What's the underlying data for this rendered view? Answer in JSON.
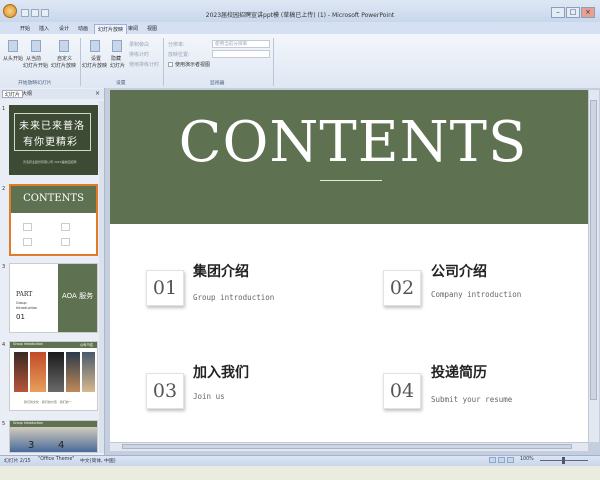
{
  "window": {
    "title": "2023届校园招聘宣讲ppt模 (草稿已上传) (1) - Microsoft PowerPoint",
    "controls": {
      "minimize": "–",
      "maximize": "□",
      "close": "×"
    }
  },
  "ribbon_tabs": [
    "开始",
    "插入",
    "设计",
    "动画",
    "幻灯片放映",
    "审阅",
    "视图"
  ],
  "active_tab": "幻灯片放映",
  "ribbon": {
    "group1": {
      "buttons": [
        {
          "line1": "从头开始",
          "line2": ""
        },
        {
          "line1": "从当前",
          "line2": "幻灯片开始"
        },
        {
          "line1": "自定义",
          "line2": "幻灯片放映"
        }
      ],
      "label": "开始放映幻灯片"
    },
    "group2": {
      "buttons": [
        {
          "line1": "设置",
          "line2": "幻灯片放映"
        },
        {
          "line1": "隐藏",
          "line2": "幻灯片"
        }
      ],
      "small": [
        "录制旁白",
        "排练计时",
        "使用排练计时"
      ],
      "label": "设置"
    },
    "group3": {
      "small": [
        "分辨率:",
        "放映位置:",
        "使用演示者视图"
      ],
      "combo": "使用当前分辨率",
      "label": "监视器"
    }
  },
  "pane_tabs": [
    "幻灯片",
    "大纲"
  ],
  "thumbnails": {
    "s1": {
      "num": "1",
      "line1": "未来已来普洛",
      "line2": "有你更精彩",
      "caption": "普洛药业股份有限公司 2023届校园招聘"
    },
    "s2": {
      "num": "2",
      "title": "CONTENTS"
    },
    "s3": {
      "num": "3",
      "part": "PART",
      "sub1": "Group",
      "sub2": "Introduction",
      "n": "01",
      "right": "AOA 服务"
    },
    "s4": {
      "num": "4",
      "header": "Group introduction",
      "tag": "公司介绍",
      "caption": "我们的文化 · 我们的价值 · 我们的一"
    },
    "s5": {
      "num": "5",
      "header": "Group introduction",
      "n1": "3",
      "n2": "4"
    }
  },
  "slide": {
    "title": "CONTENTS",
    "items": [
      {
        "num": "01",
        "title": "集团介绍",
        "subtitle": "Group introduction"
      },
      {
        "num": "02",
        "title": "公司介绍",
        "subtitle": "Company introduction"
      },
      {
        "num": "03",
        "title": "加入我们",
        "subtitle": "Join us"
      },
      {
        "num": "04",
        "title": "投递简历",
        "subtitle": "Submit your resume"
      }
    ]
  },
  "status": {
    "slide_count": "幻灯片 2/15",
    "theme": "\"Office Theme\"",
    "language": "中文(简体, 中国)",
    "zoom": "100%"
  },
  "colors": {
    "header_green": "#5e7252",
    "accent_orange": "#e07b2a"
  }
}
